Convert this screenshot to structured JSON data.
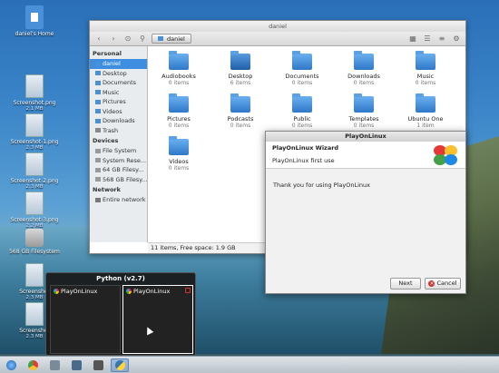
{
  "desktop": {
    "icons": [
      {
        "label": "daniel's Home",
        "size": ""
      },
      {
        "label": "Screenshot.png",
        "size": "2.1 MB"
      },
      {
        "label": "Screenshot-1.png",
        "size": "2.3 MB"
      },
      {
        "label": "Screenshot-2.png",
        "size": "2.3 MB"
      },
      {
        "label": "Screenshot-3.png",
        "size": "2.2 MB"
      },
      {
        "label": "568 GB Filesystem",
        "size": ""
      },
      {
        "label": "Screenshot",
        "size": "2.3 MB"
      },
      {
        "label": "Screenshot",
        "size": "2.3 MB"
      }
    ]
  },
  "file_manager": {
    "title": "daniel",
    "path": "daniel",
    "sidebar": {
      "personal_label": "Personal",
      "personal": [
        "daniel",
        "Desktop",
        "Documents",
        "Music",
        "Pictures",
        "Videos",
        "Downloads",
        "Trash"
      ],
      "devices_label": "Devices",
      "devices": [
        "File System",
        "System Rese...",
        "64 GB Filesy...",
        "568 GB Filesy..."
      ],
      "network_label": "Network",
      "network": [
        "Entire network"
      ]
    },
    "items": [
      {
        "name": "Audiobooks",
        "count": "0 items"
      },
      {
        "name": "Desktop",
        "count": "6 items"
      },
      {
        "name": "Documents",
        "count": "0 items"
      },
      {
        "name": "Downloads",
        "count": "0 items"
      },
      {
        "name": "Music",
        "count": "0 items"
      },
      {
        "name": "",
        "count": ""
      },
      {
        "name": "Pictures",
        "count": "0 items"
      },
      {
        "name": "Podcasts",
        "count": "0 items"
      },
      {
        "name": "Public",
        "count": "0 items"
      },
      {
        "name": "Templates",
        "count": "0 items"
      },
      {
        "name": "Ubuntu One",
        "count": "1 item"
      },
      {
        "name": "",
        "count": ""
      },
      {
        "name": "Videos",
        "count": "0 items"
      }
    ],
    "status": "11 items, Free space: 1.9 GB"
  },
  "wizard": {
    "window_title": "PlayOnLinux",
    "heading": "PlayOnLinux Wizard",
    "subheading": "PlayOnLinux first use",
    "message": "Thank you for using PlayOnLinux",
    "next_label": "Next",
    "cancel_label": "Cancel"
  },
  "switcher": {
    "title": "Python (v2.7)",
    "windows": [
      "PlayOnLinux",
      "PlayOnLinux"
    ]
  }
}
